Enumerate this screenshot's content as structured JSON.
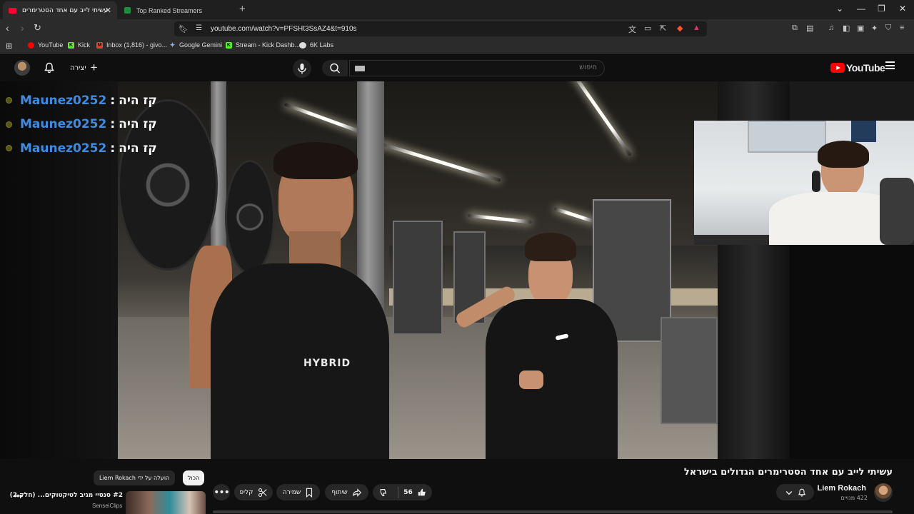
{
  "browser": {
    "tabs": [
      {
        "title": "עשיתי לייב עם אחד הסטרימרים",
        "active": true,
        "favicon_color": "#ff0033"
      },
      {
        "title": "Top Ranked Streamers",
        "active": false,
        "favicon_color": "#1e8e3e"
      }
    ],
    "url": "youtube.com/watch?v=PFSHt3SsAZ4&t=910s",
    "bookmarks": [
      {
        "label": "YouTube",
        "icon": "youtube-icon",
        "color": "#ff0000"
      },
      {
        "label": "Kick",
        "icon": "kick-icon",
        "color": "#53fc18"
      },
      {
        "label": "Inbox (1,816) - givo...",
        "icon": "gmail-icon",
        "color": "#ea4335"
      },
      {
        "label": "Google Gemini",
        "icon": "gemini-icon",
        "color": "#8ab4f8"
      },
      {
        "label": "Stream - Kick Dashb...",
        "icon": "kick-icon",
        "color": "#53fc18"
      },
      {
        "label": "6K Labs",
        "icon": "6k-labs-icon",
        "color": "#dddddd"
      }
    ]
  },
  "youtube": {
    "logo_text": "YouTube",
    "search_placeholder": "חיפוש",
    "create_label": "יצירה"
  },
  "stream_chat": [
    {
      "user": "Maunez0252",
      "message": "קז היה"
    },
    {
      "user": "Maunez0252",
      "message": "קז היה"
    },
    {
      "user": "Maunez0252",
      "message": "קז היה"
    }
  ],
  "video": {
    "title": "עשיתי לייב עם אחד הסטרימרים הגדולים בישראל",
    "channel_name": "Liem Rokach",
    "subscribers": "422 מנויים",
    "likes": "56",
    "share_label": "שיתוף",
    "save_label": "שמירה",
    "clip_label": "קליפ",
    "shirt_text": "HYBRID"
  },
  "recommendations": {
    "filters": {
      "all": "הכול",
      "uploaded_by": "הועלה על ידי Liem Rokach"
    },
    "item": {
      "rank": "#2",
      "title": "סנסיי מגיב לטיקטוקים... (חלק 2)",
      "channel": "SenseiClips"
    }
  }
}
